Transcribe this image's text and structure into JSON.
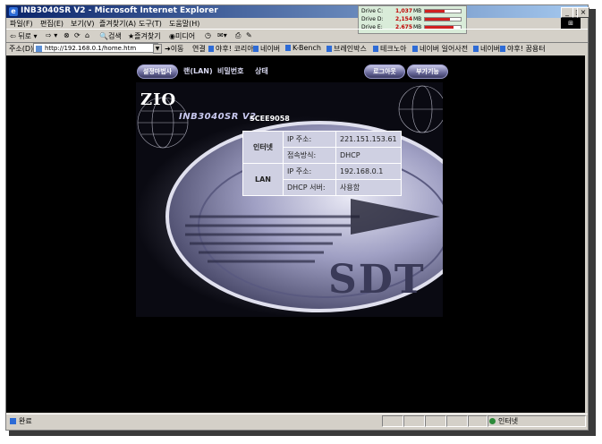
{
  "window": {
    "title": "INB3040SR V2 - Microsoft Internet Explorer"
  },
  "drives": [
    {
      "label": "Drive C:",
      "value": "1,037",
      "unit": "MB",
      "fill": 0.55
    },
    {
      "label": "Drive D:",
      "value": "2,154",
      "unit": "MB",
      "fill": 0.7
    },
    {
      "label": "Drive E:",
      "value": "2,675",
      "unit": "MB",
      "fill": 0.8
    }
  ],
  "menu": [
    "파일(F)",
    "편집(E)",
    "보기(V)",
    "즐겨찾기(A)",
    "도구(T)",
    "도움말(H)"
  ],
  "toolbar": {
    "back": "뒤로",
    "search": "검색",
    "favorites": "즐겨찾기",
    "media": "미디어"
  },
  "address": {
    "label": "주소(D)",
    "url": "http://192.168.0.1/home.htm",
    "go": "이동",
    "links_label": "연결",
    "links": [
      "야후! 코리아",
      "네이버",
      "K-Bench",
      "브레인박스",
      "테크노아",
      "네이버 일어사전",
      "네이버",
      "야후! 꿈용터"
    ]
  },
  "nav": {
    "setup_wizard": "설정마법사",
    "wan_lan": "랜(LAN)",
    "password": "비밀번호",
    "status": "상태",
    "logout": "로그아웃",
    "extras": "부가기능"
  },
  "device": {
    "brand": "ZIO",
    "model": "INB3040SR V2",
    "serial": "SCEE9058",
    "watermark": "SDT"
  },
  "info_table": {
    "internet": {
      "section": "인터넷",
      "rows": [
        {
          "key": "IP 주소:",
          "value": "221.151.153.61"
        },
        {
          "key": "접속방식:",
          "value": "DHCP"
        }
      ]
    },
    "lan": {
      "section": "LAN",
      "rows": [
        {
          "key": "IP 주소:",
          "value": "192.168.0.1"
        },
        {
          "key": "DHCP 서버:",
          "value": "사용함"
        }
      ]
    }
  },
  "status": {
    "text": "완료",
    "zone": "인터넷"
  }
}
